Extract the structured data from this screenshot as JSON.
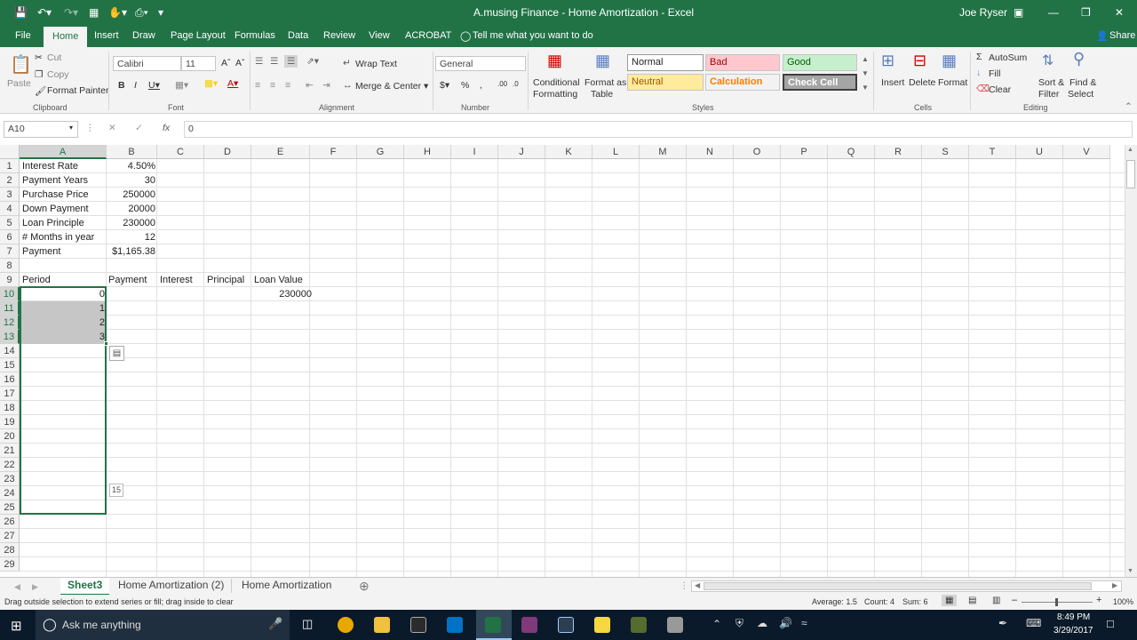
{
  "window": {
    "title": "A.musing Finance - Home Amortization  -  Excel",
    "user": "Joe Ryser"
  },
  "tabs": [
    "File",
    "Home",
    "Insert",
    "Draw",
    "Page Layout",
    "Formulas",
    "Data",
    "Review",
    "View",
    "ACROBAT"
  ],
  "tell_me": "Tell me what you want to do",
  "share": "Share",
  "ribbon": {
    "clipboard": {
      "paste": "Paste",
      "cut": "Cut",
      "copy": "Copy",
      "format_painter": "Format Painter",
      "group": "Clipboard"
    },
    "font": {
      "name": "Calibri",
      "size": "11",
      "group": "Font"
    },
    "alignment": {
      "wrap": "Wrap Text",
      "merge": "Merge & Center",
      "group": "Alignment"
    },
    "number": {
      "format": "General",
      "group": "Number"
    },
    "styles": {
      "conditional": "Conditional",
      "formatting": "Formatting",
      "format_as": "Format as",
      "table": "Table",
      "normal": "Normal",
      "bad": "Bad",
      "good": "Good",
      "neutral": "Neutral",
      "calculation": "Calculation",
      "check_cell": "Check Cell",
      "group": "Styles"
    },
    "cells": {
      "insert": "Insert",
      "delete": "Delete",
      "format": "Format",
      "group": "Cells"
    },
    "editing": {
      "autosum": "AutoSum",
      "fill": "Fill",
      "clear": "Clear",
      "sort": "Sort &",
      "filter": "Filter",
      "find": "Find &",
      "select": "Select",
      "group": "Editing"
    }
  },
  "formula_bar": {
    "name_box": "A10",
    "value": "0"
  },
  "columns": [
    "A",
    "B",
    "C",
    "D",
    "E",
    "F",
    "G",
    "H",
    "I",
    "J",
    "K",
    "L",
    "M",
    "N",
    "O",
    "P",
    "Q",
    "R",
    "S",
    "T",
    "U",
    "V"
  ],
  "rows": [
    "1",
    "2",
    "3",
    "4",
    "5",
    "6",
    "7",
    "8",
    "9",
    "10",
    "11",
    "12",
    "13",
    "14",
    "15",
    "16",
    "17",
    "18",
    "19",
    "20",
    "21",
    "22",
    "23",
    "24",
    "25",
    "26",
    "27",
    "28",
    "29"
  ],
  "cells": {
    "a1": "Interest Rate",
    "b1": "4.50%",
    "a2": "Payment Years",
    "b2": "30",
    "a3": "Purchase Price",
    "b3": "250000",
    "a4": "Down Payment",
    "b4": "20000",
    "a5": "Loan Principle",
    "b5": "230000",
    "a6": "# Months in year",
    "b6": "12",
    "a7": "Payment",
    "b7": "$1,165.38",
    "a9": "Period",
    "b9": "Payment",
    "c9": "Interest",
    "d9": "Principal",
    "e9": "Loan Value",
    "a10": "0",
    "e10": "230000",
    "a11": "1",
    "a12": "2",
    "a13": "3"
  },
  "fill_tooltip": "15",
  "sheets": [
    "Sheet3",
    "Home Amortization (2)",
    "Home Amortization"
  ],
  "status": {
    "message": "Drag outside selection to extend series or fill; drag inside to clear",
    "average": "Average: 1.5",
    "count": "Count: 4",
    "sum": "Sum: 6",
    "zoom": "100%"
  },
  "taskbar": {
    "search": "Ask me anything",
    "time": "8:49 PM",
    "date": "3/29/2017"
  }
}
